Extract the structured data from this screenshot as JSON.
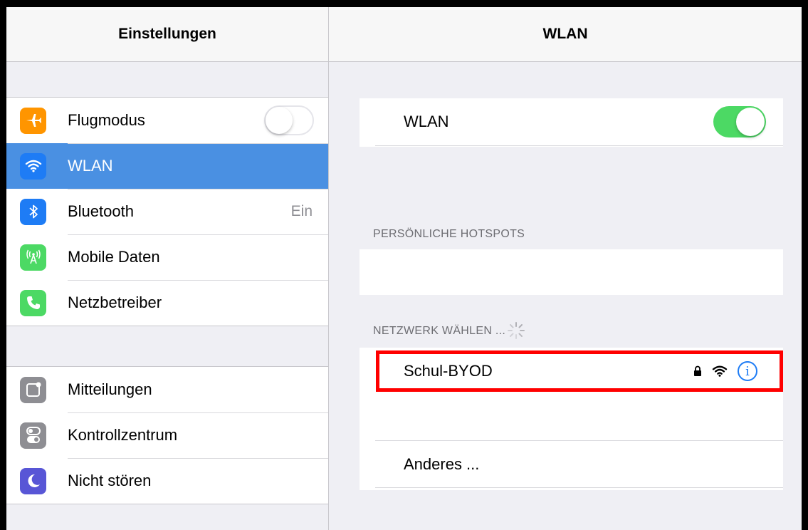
{
  "left": {
    "title": "Einstellungen",
    "group1": [
      {
        "label": "Flugmodus",
        "icon": "airplane-icon",
        "color": "#ff9500",
        "toggle": "off"
      },
      {
        "label": "WLAN",
        "icon": "wifi-icon",
        "color": "#1e7cf5",
        "selected": true
      },
      {
        "label": "Bluetooth",
        "icon": "bluetooth-icon",
        "color": "#1e7cf5",
        "detail": "Ein"
      },
      {
        "label": "Mobile Daten",
        "icon": "antenna-icon",
        "color": "#4cd964"
      },
      {
        "label": "Netzbetreiber",
        "icon": "phone-icon",
        "color": "#4cd964"
      }
    ],
    "group2": [
      {
        "label": "Mitteilungen",
        "icon": "notifications-icon",
        "color": "#8e8e93"
      },
      {
        "label": "Kontrollzentrum",
        "icon": "control-center-icon",
        "color": "#8e8e93"
      },
      {
        "label": "Nicht stören",
        "icon": "moon-icon",
        "color": "#5856d6"
      }
    ]
  },
  "right": {
    "title": "WLAN",
    "wlan_label": "WLAN",
    "wlan_toggle": "on",
    "hotspots_header": "PERSÖNLICHE HOTSPOTS",
    "networks_header": "NETZWERK WÄHLEN ...",
    "networks": [
      {
        "name": "Schul-BYOD",
        "secured": true
      }
    ],
    "other_label": "Anderes ..."
  },
  "colors": {
    "accent": "#1e7cf5",
    "toggle_on": "#4cd964",
    "selected_row": "#4a90e2",
    "highlight": "#ff0000"
  }
}
